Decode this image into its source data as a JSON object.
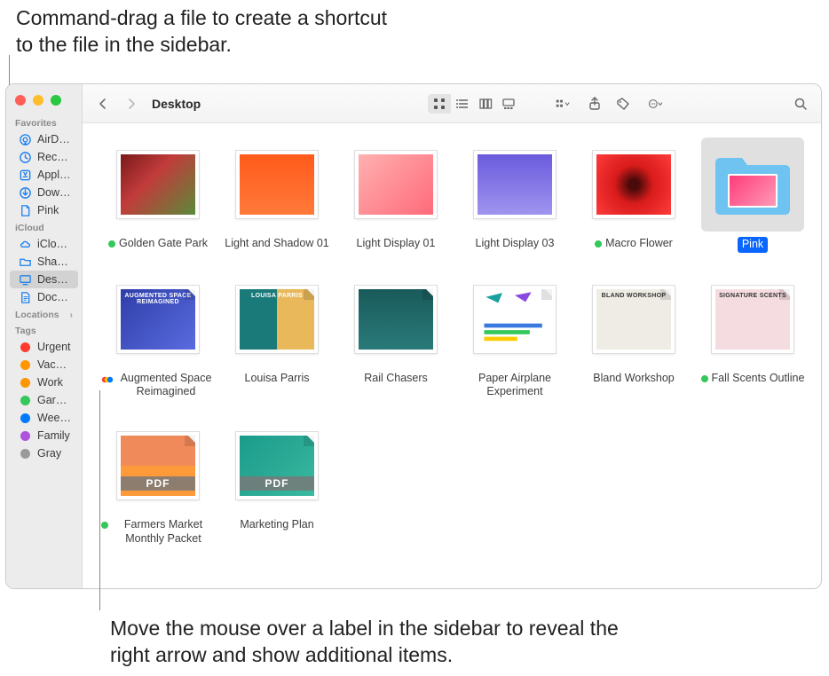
{
  "callouts": {
    "top": "Command-drag a file to create a shortcut to the file in the sidebar.",
    "bottom": "Move the mouse over a label in the sidebar to reveal the right arrow and show additional items."
  },
  "window": {
    "title": "Desktop",
    "sidebar": {
      "sections": [
        {
          "heading": "Favorites",
          "items": [
            {
              "icon": "airdrop",
              "label": "AirDrop"
            },
            {
              "icon": "recents",
              "label": "Recents"
            },
            {
              "icon": "apps",
              "label": "Applications"
            },
            {
              "icon": "downloads",
              "label": "Downloads"
            },
            {
              "icon": "file",
              "label": "Pink"
            }
          ]
        },
        {
          "heading": "iCloud",
          "items": [
            {
              "icon": "icloud",
              "label": "iCloud…"
            },
            {
              "icon": "folder",
              "label": "Shared"
            },
            {
              "icon": "desktop",
              "label": "Desktop",
              "selected": true
            },
            {
              "icon": "doc",
              "label": "Documents"
            }
          ]
        },
        {
          "heading": "Locations",
          "chevron": true,
          "items": []
        },
        {
          "heading": "Tags",
          "items": [
            {
              "tag": true,
              "color": "#ff3b30",
              "label": "Urgent"
            },
            {
              "tag": true,
              "color": "#ff9500",
              "label": "Vacation"
            },
            {
              "tag": true,
              "color": "#ff9500",
              "label": "Work"
            },
            {
              "tag": true,
              "color": "#34c759",
              "label": "Garden"
            },
            {
              "tag": true,
              "color": "#007aff",
              "label": "Weekend"
            },
            {
              "tag": true,
              "color": "#af52de",
              "label": "Family"
            },
            {
              "tag": true,
              "color": "#9a9a9a",
              "label": "Gray"
            }
          ]
        }
      ]
    },
    "files": [
      {
        "name": "Golden Gate Park",
        "tag": "#34c759",
        "kind": "image",
        "ph": "linear-gradient(135deg,#7a1a1a,#c23b3b 40%,#5a8a3a)"
      },
      {
        "name": "Light and Shadow 01",
        "kind": "image",
        "ph": "linear-gradient(180deg,#ff5a1a,#ff7a3a)"
      },
      {
        "name": "Light Display 01",
        "kind": "image",
        "ph": "linear-gradient(135deg,#ffb0b0,#ff6a7a)"
      },
      {
        "name": "Light Display 03",
        "kind": "image",
        "ph": "linear-gradient(180deg,#6a5bdc,#a094f0)"
      },
      {
        "name": "Macro Flower",
        "tag": "#34c759",
        "kind": "image",
        "ph": "radial-gradient(circle at 50% 50%,#4a0a0a 10%,#d81b1b 40%,#ff3b3b)"
      },
      {
        "name": "Pink",
        "kind": "folder",
        "selected": true,
        "ph": "linear-gradient(135deg,#ff3b7a,#ff9ab8)"
      },
      {
        "name": "Augmented Space Reimagined",
        "kind": "doc",
        "multi": true,
        "ph": "linear-gradient(135deg,#2e3ea8,#5a6be0)",
        "text": "AUGMENTED SPACE REIMAGINED"
      },
      {
        "name": "Louisa Parris",
        "kind": "doc",
        "ph": "linear-gradient(90deg,#1a7a7a 50%,#e8b85a 50%)",
        "text": "LOUISA PARRIS"
      },
      {
        "name": "Rail Chasers",
        "kind": "doc",
        "ph": "linear-gradient(180deg,#1a5a5a,#2a7a7a)"
      },
      {
        "name": "Paper Airplane Experiment",
        "kind": "doc",
        "ph": "#ffffff",
        "chart": true
      },
      {
        "name": "Bland Workshop",
        "kind": "doc",
        "ph": "#efece6",
        "text": "BLAND WORKSHOP"
      },
      {
        "name": "Fall Scents Outline",
        "tag": "#34c759",
        "kind": "doc",
        "ph": "#f5dce0",
        "text": "SIGNATURE SCENTS"
      },
      {
        "name": "Farmers Market Monthly Packet",
        "tag": "#34c759",
        "kind": "pdf",
        "ph": "linear-gradient(180deg,#f08a5a 50%,#ff9a3a 50%)"
      },
      {
        "name": "Marketing Plan",
        "kind": "pdf",
        "ph": "linear-gradient(135deg,#1a9a8a,#3abaa0)"
      }
    ]
  },
  "colors": {
    "accent": "#0a66ff",
    "sidebar_icon": "#1b80f0"
  }
}
